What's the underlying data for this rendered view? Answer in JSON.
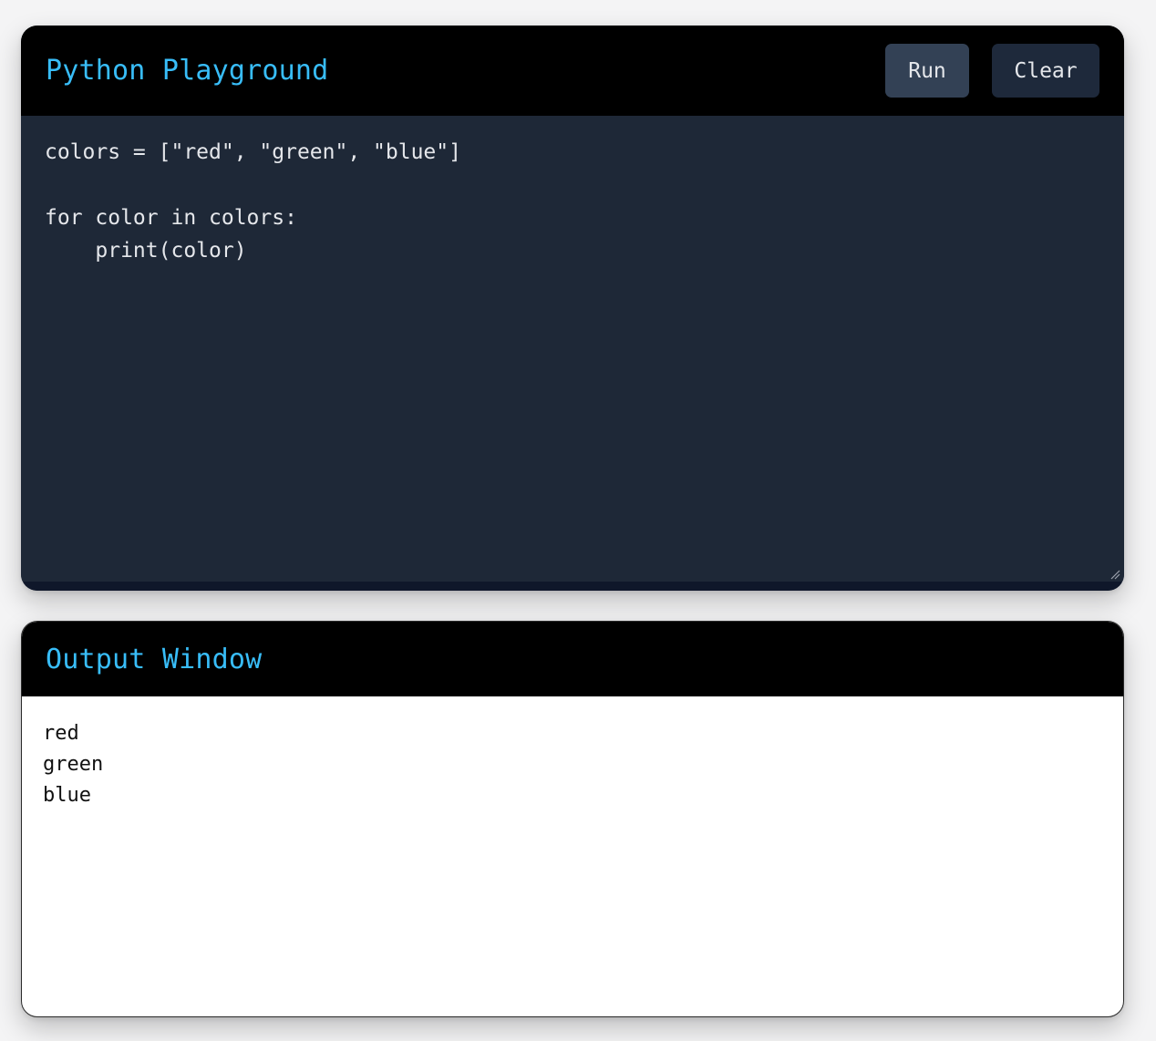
{
  "editor": {
    "title": "Python Playground",
    "run_label": "Run",
    "clear_label": "Clear",
    "code": "colors = [\"red\", \"green\", \"blue\"]\n\nfor color in colors:\n    print(color)"
  },
  "output": {
    "title": "Output Window",
    "text": "red\ngreen\nblue"
  },
  "colors": {
    "accent": "#38bdf8",
    "header_bg": "#000000",
    "editor_bg": "#1e2837",
    "run_button": "#334155",
    "clear_button": "#1e293b"
  }
}
